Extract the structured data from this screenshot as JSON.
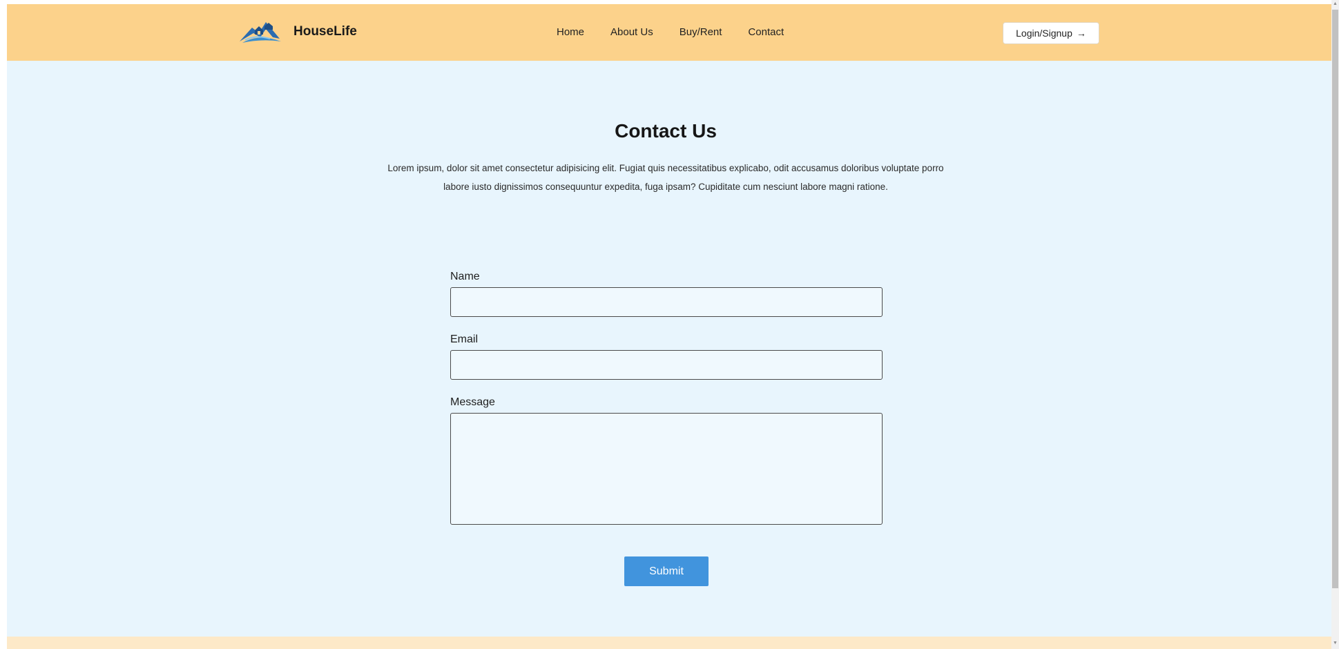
{
  "navbar": {
    "brand": "HouseLife",
    "links": [
      "Home",
      "About Us",
      "Buy/Rent",
      "Contact"
    ],
    "login_label": "Login/Signup",
    "login_icon": "arrow-right-icon",
    "logo_icon": "house-mountain-logo"
  },
  "main": {
    "title": "Contact Us",
    "lead": "Lorem ipsum, dolor sit amet consectetur adipisicing elit. Fugiat quis necessitatibus explicabo, odit accusamus doloribus voluptate porro labore iusto dignissimos consequuntur expedita, fuga ipsam? Cupiditate cum nesciunt labore magni ratione."
  },
  "form": {
    "name_label": "Name",
    "name_value": "",
    "email_label": "Email",
    "email_value": "",
    "message_label": "Message",
    "message_value": "",
    "submit_label": "Submit"
  },
  "colors": {
    "navbar_bg": "#fcd28b",
    "page_bg": "#e8f5fd",
    "submit_bg": "#4194dd",
    "footer_bg": "#fde9c8"
  }
}
